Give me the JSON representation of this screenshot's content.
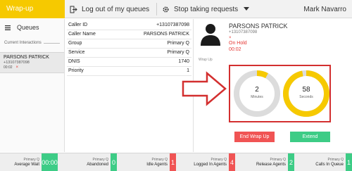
{
  "topbar": {
    "wrapup_label": "Wrap-up",
    "logout_label": "Log out of my queues",
    "stop_label": "Stop taking requests",
    "user_name": "Mark Navarro"
  },
  "sidebar": {
    "queues_label": "Queues",
    "current_interactions_label": "Current Interactions",
    "interaction": {
      "name": "PARSONS PATRICK",
      "number": "+13107387098",
      "time": "00:02",
      "close_glyph": "×"
    }
  },
  "info": {
    "rows": [
      {
        "key": "Caller ID",
        "value": "+13107387098"
      },
      {
        "key": "Caller Name",
        "value": "PARSONS PATRICK"
      },
      {
        "key": "Group",
        "value": "Primary Q"
      },
      {
        "key": "Service",
        "value": "Primary Q"
      },
      {
        "key": "DNIS",
        "value": "1740"
      },
      {
        "key": "Priority",
        "value": "1"
      }
    ]
  },
  "detail": {
    "name": "PARSONS PATRICK",
    "number": "+13107387098",
    "x_glyph": "×",
    "status": "On Hold",
    "hold_time": "00:02",
    "wrap_up_label": "Wrap Up",
    "timers": [
      {
        "value": "2",
        "unit": "Minutes",
        "progress": 0.08,
        "color": "#f6c900"
      },
      {
        "value": "58",
        "unit": "Seconds",
        "progress": 0.97,
        "color": "#f6c900"
      }
    ],
    "end_wrap_label": "End Wrap Up",
    "extend_label": "Extend"
  },
  "status_bar": [
    {
      "queue": "Primary Q",
      "name": "Average Wait",
      "value": "00:00",
      "color": "#3dcc86"
    },
    {
      "queue": "Primary Q",
      "name": "Abandoned",
      "value": "0",
      "color": "#3dcc86"
    },
    {
      "queue": "Primary Q",
      "name": "Idle Agents",
      "value": "1",
      "color": "#f05454"
    },
    {
      "queue": "Primary Q",
      "name": "Logged In Agents",
      "value": "4",
      "color": "#f05454"
    },
    {
      "queue": "Primary Q",
      "name": "Release Agents",
      "value": "2",
      "color": "#3dcc86"
    },
    {
      "queue": "Primary Q",
      "name": "Calls In Queue",
      "value": "1",
      "color": "#3dcc86"
    }
  ],
  "colors": {
    "accent": "#f6c900",
    "danger": "#e53935",
    "success": "#3dcc86",
    "highlight_box": "#d32f2f"
  }
}
